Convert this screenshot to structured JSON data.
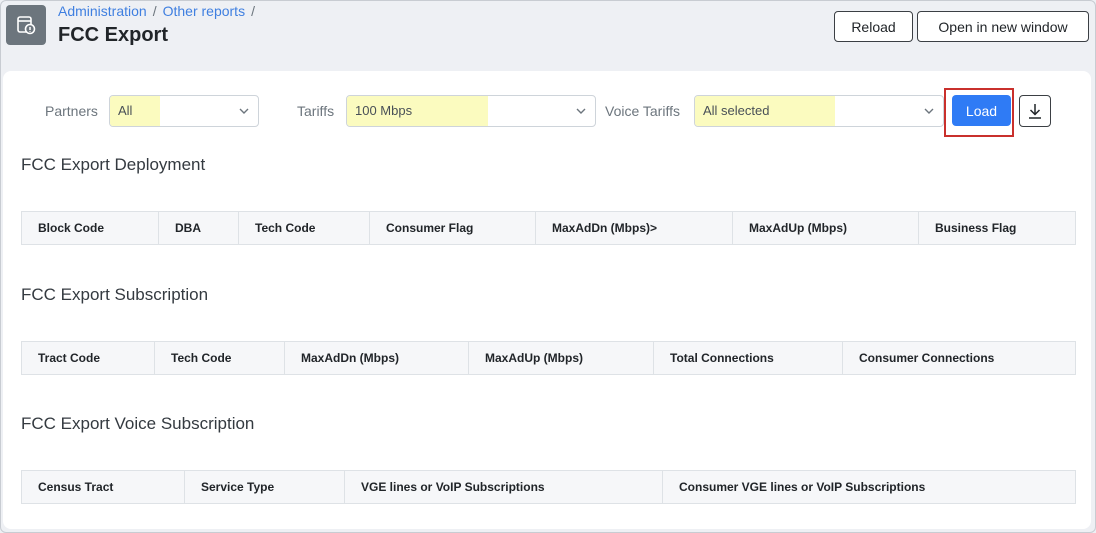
{
  "breadcrumb": {
    "items": [
      "Administration",
      "Other reports"
    ],
    "separator": "/"
  },
  "page": {
    "title": "FCC Export"
  },
  "header_buttons": {
    "reload": "Reload",
    "open_new_window": "Open in new window"
  },
  "filters": {
    "partners": {
      "label": "Partners",
      "value": "All"
    },
    "tariffs": {
      "label": "Tariffs",
      "value": "100 Mbps"
    },
    "voice_tariffs": {
      "label": "Voice Tariffs",
      "value": "All selected"
    },
    "load_label": "Load"
  },
  "sections": {
    "deployment": {
      "title": "FCC Export Deployment",
      "columns": [
        "Block Code",
        "DBA",
        "Tech Code",
        "Consumer Flag",
        "MaxAdDn (Mbps)>",
        "MaxAdUp (Mbps)",
        "Business Flag"
      ]
    },
    "subscription": {
      "title": "FCC Export Subscription",
      "columns": [
        "Tract Code",
        "Tech Code",
        "MaxAdDn (Mbps)",
        "MaxAdUp (Mbps)",
        "Total Connections",
        "Consumer Connections"
      ]
    },
    "voice": {
      "title": "FCC Export Voice Subscription",
      "columns": [
        "Census Tract",
        "Service Type",
        "VGE lines or VoIP Subscriptions",
        "Consumer VGE lines or VoIP Subscriptions"
      ]
    }
  },
  "colors": {
    "accent": "#2f7bf5",
    "highlight": "#fbfbbf",
    "callout": "#c9302c"
  }
}
